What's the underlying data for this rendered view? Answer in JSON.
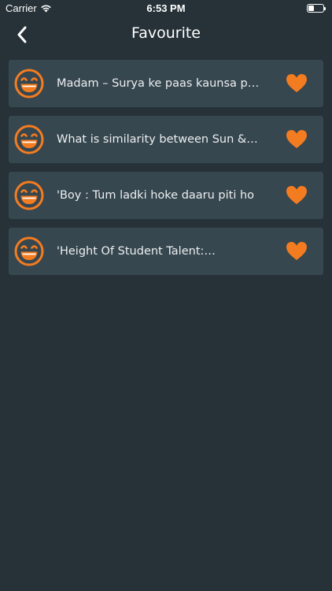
{
  "status_bar": {
    "carrier": "Carrier",
    "time": "6:53 PM"
  },
  "nav": {
    "title": "Favourite",
    "back_icon": "chevron-left-icon"
  },
  "items": [
    {
      "text": "Madam – Surya ke paas kaunsa planet hai",
      "icon": "grinning-face-icon",
      "favorite": true
    },
    {
      "text": "What is similarity between Sun  & Moon",
      "icon": "grinning-face-icon",
      "favorite": true
    },
    {
      "text": "'Boy : Tum ladki hoke daaru piti ho",
      "icon": "grinning-face-icon",
      "favorite": true
    },
    {
      "text": "'Height Of Student Talent:…",
      "icon": "grinning-face-icon",
      "favorite": true
    }
  ],
  "colors": {
    "background": "#263238",
    "card": "#37474f",
    "accent": "#f47c20"
  }
}
